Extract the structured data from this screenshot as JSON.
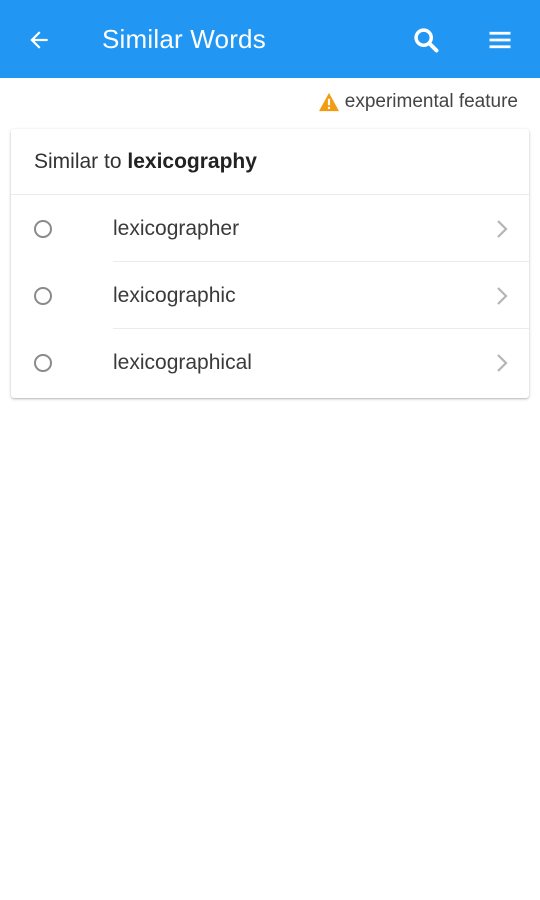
{
  "appbar": {
    "title": "Similar Words",
    "color": "#2196f3",
    "icons": {
      "back": "arrow-back-icon",
      "search": "search-icon",
      "menu": "menu-icon"
    }
  },
  "notice": {
    "icon": "warning-icon",
    "icon_color": "#f39c12",
    "text": "experimental feature"
  },
  "card": {
    "header_prefix": "Similar to",
    "header_word": "lexicography",
    "items": [
      {
        "label": "lexicographer",
        "selected": false
      },
      {
        "label": "lexicographic",
        "selected": false
      },
      {
        "label": "lexicographical",
        "selected": false
      }
    ]
  }
}
